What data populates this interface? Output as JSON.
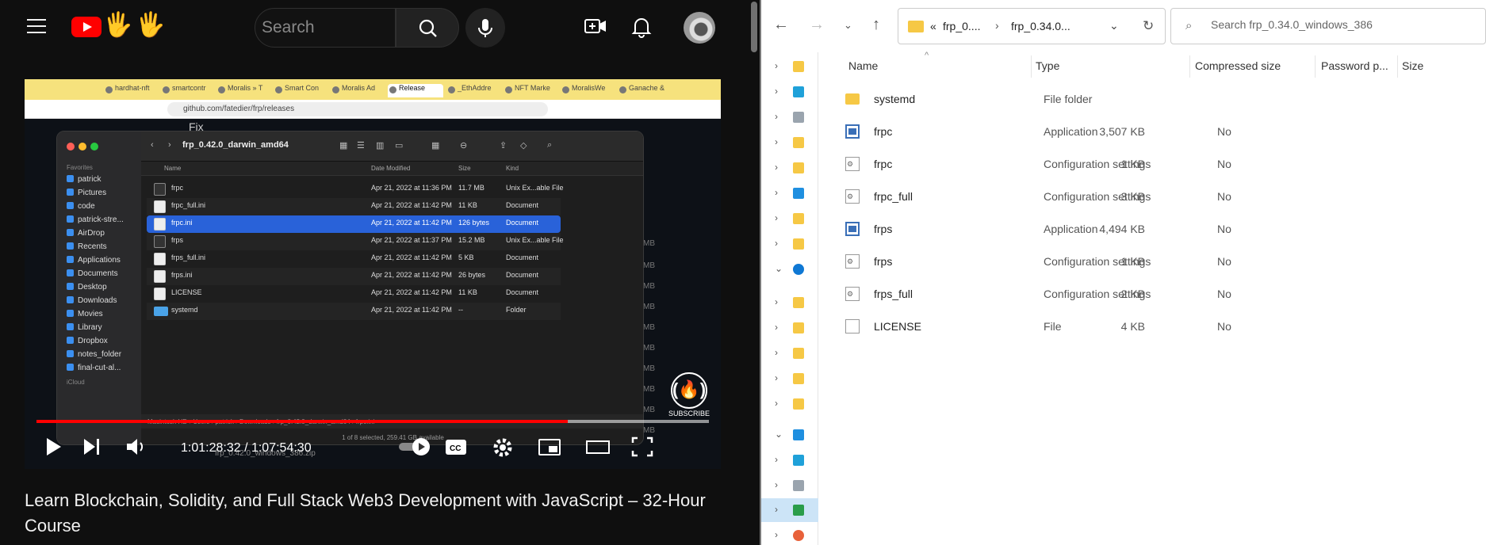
{
  "youtube": {
    "search_placeholder": "Search",
    "video": {
      "time_display": "1:01:28:32 / 1:07:54:30",
      "progress_fraction": 0.79,
      "subscribe_label": "SUBSCRIBE",
      "browser": {
        "tabs": [
          "hardhat-nft",
          "smartcontr",
          "Moralis » T",
          "Smart Con",
          "Moralis Ad",
          "Release",
          "_EthAddre",
          "NFT Marke",
          "MoralisWe",
          "Ganache &"
        ],
        "active_tab_index": 5,
        "url": "github.com/fatedier/frp/releases",
        "page_heading": "Fix",
        "size_labels": [
          "MB",
          "MB",
          "MB",
          "MB",
          "MB",
          "MB",
          "MB",
          "MB",
          "MB",
          "MB"
        ]
      },
      "finder": {
        "title": "frp_0.42.0_darwin_amd64",
        "favorites_label": "Favorites",
        "sidebar": [
          "patrick",
          "Pictures",
          "code",
          "patrick-stre...",
          "AirDrop",
          "Recents",
          "Applications",
          "Documents",
          "Desktop",
          "Downloads",
          "Movies",
          "Library",
          "Dropbox",
          "notes_folder",
          "final-cut-al..."
        ],
        "icloud_label": "iCloud",
        "columns": {
          "name": "Name",
          "date": "Date Modified",
          "size": "Size",
          "kind": "Kind"
        },
        "rows": [
          {
            "name": "frpc",
            "date": "Apr 21, 2022 at 11:36 PM",
            "size": "11.7 MB",
            "kind": "Unix Ex...able File",
            "icon": "exec"
          },
          {
            "name": "frpc_full.ini",
            "date": "Apr 21, 2022 at 11:42 PM",
            "size": "11 KB",
            "kind": "Document",
            "icon": "doc"
          },
          {
            "name": "frpc.ini",
            "date": "Apr 21, 2022 at 11:42 PM",
            "size": "126 bytes",
            "kind": "Document",
            "icon": "doc"
          },
          {
            "name": "frps",
            "date": "Apr 21, 2022 at 11:37 PM",
            "size": "15.2 MB",
            "kind": "Unix Ex...able File",
            "icon": "exec"
          },
          {
            "name": "frps_full.ini",
            "date": "Apr 21, 2022 at 11:42 PM",
            "size": "5 KB",
            "kind": "Document",
            "icon": "doc"
          },
          {
            "name": "frps.ini",
            "date": "Apr 21, 2022 at 11:42 PM",
            "size": "26 bytes",
            "kind": "Document",
            "icon": "doc"
          },
          {
            "name": "LICENSE",
            "date": "Apr 21, 2022 at 11:42 PM",
            "size": "11 KB",
            "kind": "Document",
            "icon": "doc"
          },
          {
            "name": "systemd",
            "date": "Apr 21, 2022 at 11:42 PM",
            "size": "--",
            "kind": "Folder",
            "icon": "folder"
          }
        ],
        "selected_row_index": 2,
        "path_bar": "Macintosh HD › Users › patrick › Downloads › frp_0.42.0_darwin_amd64 › frpc.ini",
        "status": "1 of 8 selected, 259.41 GB available",
        "overlay_file": "frp_0.42.0_windows_386.zip"
      }
    },
    "title": "Learn Blockchain, Solidity, and Full Stack Web3 Development with JavaScript – 32-Hour Course",
    "colors": {
      "accent": "#ff0000",
      "background": "#0f0f0f",
      "finder_selection": "#2962d9"
    }
  },
  "explorer": {
    "breadcrumb": {
      "overflow": "«",
      "parent": "frp_0....",
      "current": "frp_0.34.0..."
    },
    "search_placeholder": "Search frp_0.34.0_windows_386",
    "columns": {
      "name": "Name",
      "type": "Type",
      "compressed": "Compressed size",
      "password": "Password p...",
      "size": "Size"
    },
    "rows": [
      {
        "name": "systemd",
        "type": "File folder",
        "compressed": "",
        "password": "",
        "icon": "folder"
      },
      {
        "name": "frpc",
        "type": "Application",
        "compressed": "3,507 KB",
        "password": "No",
        "icon": "app"
      },
      {
        "name": "frpc",
        "type": "Configuration settings",
        "compressed": "1 KB",
        "password": "No",
        "icon": "cfg"
      },
      {
        "name": "frpc_full",
        "type": "Configuration settings",
        "compressed": "3 KB",
        "password": "No",
        "icon": "cfg"
      },
      {
        "name": "frps",
        "type": "Application",
        "compressed": "4,494 KB",
        "password": "No",
        "icon": "app"
      },
      {
        "name": "frps",
        "type": "Configuration settings",
        "compressed": "1 KB",
        "password": "No",
        "icon": "cfg"
      },
      {
        "name": "frps_full",
        "type": "Configuration settings",
        "compressed": "2 KB",
        "password": "No",
        "icon": "cfg"
      },
      {
        "name": "LICENSE",
        "type": "File",
        "compressed": "4 KB",
        "password": "No",
        "icon": "file"
      }
    ]
  }
}
